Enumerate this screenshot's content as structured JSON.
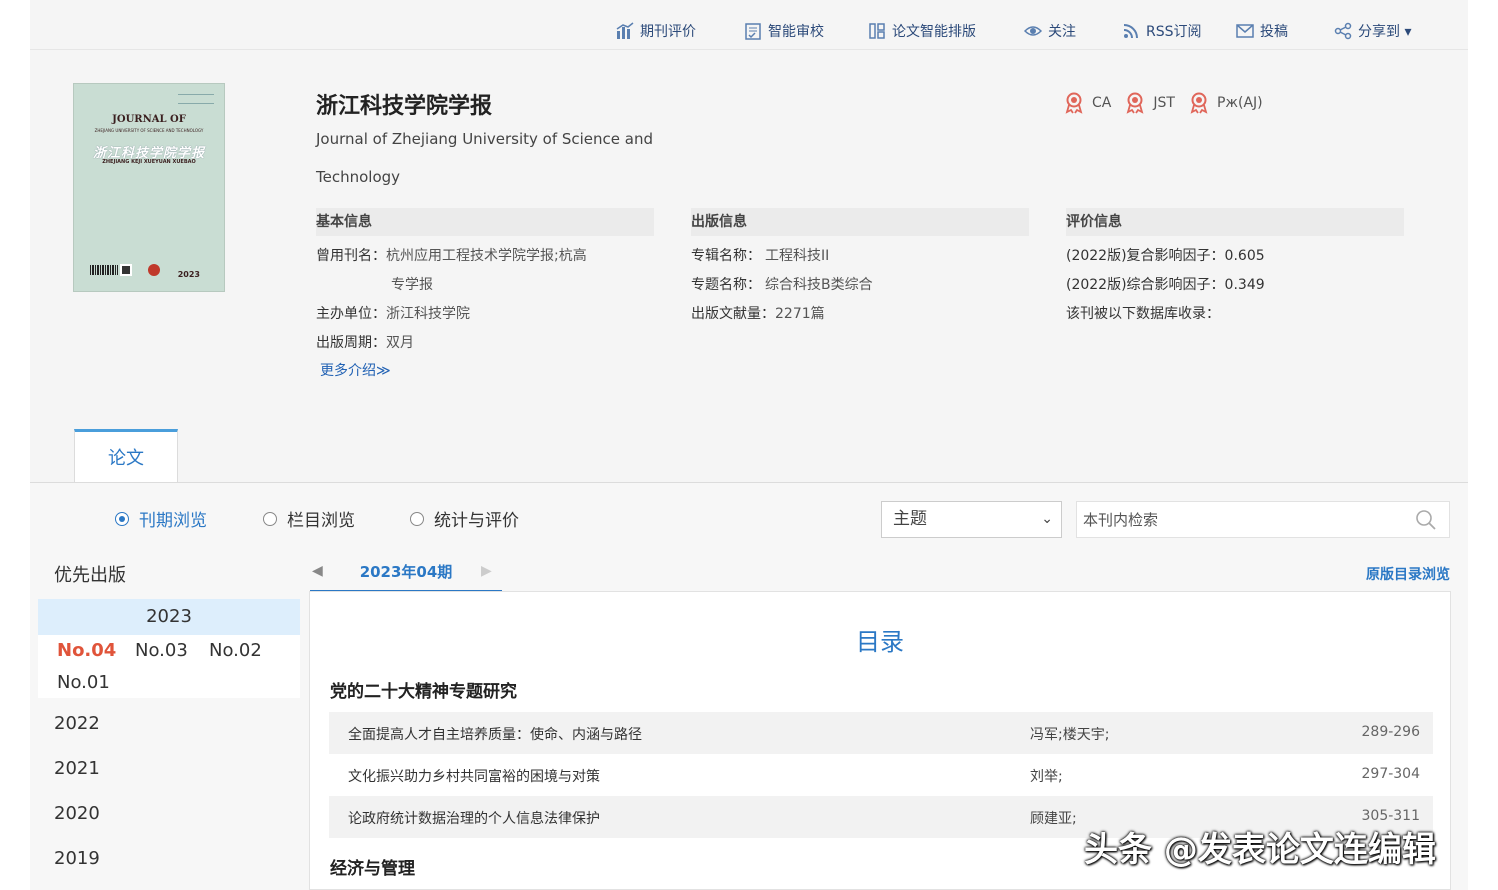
{
  "toolbar": {
    "items": [
      {
        "label": "期刊评价"
      },
      {
        "label": "智能审校"
      },
      {
        "label": "论文智能排版"
      },
      {
        "label": "关注"
      },
      {
        "label": "RSS订阅"
      },
      {
        "label": "投稿"
      },
      {
        "label": "分享到 ▾"
      }
    ]
  },
  "journal": {
    "title": "浙江科技学院学报",
    "title_en": "Journal of Zhejiang University of Science and Technology",
    "cover": {
      "line1": "JOURNAL OF",
      "line2": "ZHEJIANG UNIVERSITY OF SCIENCE AND TECHNOLOGY",
      "line3": "浙江科技学院学报",
      "line4": "ZHEJIANG KEJI XUEYUAN XUEBAO",
      "year": "2023"
    },
    "badges": [
      "CA",
      "JST",
      "Рж(AJ)"
    ]
  },
  "basic_info": {
    "heading": "基本信息",
    "former_name_label": "曾用刊名：",
    "former_name_value_1": "杭州应用工程技术学院学报;杭高",
    "former_name_value_2": "专学报",
    "sponsor_label": "主办单位：",
    "sponsor_value": "浙江科技学院",
    "cycle_label": "出版周期：",
    "cycle_value": "双月",
    "more": "更多介绍≫"
  },
  "publish_info": {
    "heading": "出版信息",
    "album_label": "专辑名称：",
    "album_value": "工程科技II",
    "topic_label": "专题名称：",
    "topic_value": "综合科技B类综合",
    "count_label": "出版文献量：",
    "count_value": "2271篇"
  },
  "eval_info": {
    "heading": "评价信息",
    "if_composite": "(2022版)复合影响因子：0.605",
    "if_comprehensive": "(2022版)综合影响因子：0.349",
    "indexed": "该刊被以下数据库收录："
  },
  "tabs": {
    "papers": "论文"
  },
  "browse": {
    "options": [
      "刊期浏览",
      "栏目浏览",
      "统计与评价"
    ],
    "select_value": "主题",
    "search_placeholder": "本刊内检索"
  },
  "sidebar": {
    "priority": "优先出版",
    "open_year": "2023",
    "issues": [
      "No.04",
      "No.03",
      "No.02",
      "No.01"
    ],
    "years": [
      "2022",
      "2021",
      "2020",
      "2019"
    ]
  },
  "issue_nav": {
    "current": "2023年04期",
    "original": "原版目录浏览"
  },
  "toc": {
    "title": "目录",
    "sections": [
      {
        "name": "党的二十大精神专题研究",
        "articles": [
          {
            "title": "全面提高人才自主培养质量：使命、内涵与路径",
            "authors": "冯军;楼天宇;",
            "pages": "289-296"
          },
          {
            "title": "文化振兴助力乡村共同富裕的困境与对策",
            "authors": "刘举;",
            "pages": "297-304"
          },
          {
            "title": "论政府统计数据治理的个人信息法律保护",
            "authors": "顾建亚;",
            "pages": "305-311"
          }
        ]
      },
      {
        "name": "经济与管理",
        "articles": []
      }
    ]
  },
  "watermark": "头条 @发表论文连编辑",
  "colors": {
    "accent": "#2b78c5",
    "active_issue": "#e0543a",
    "toolbar_text": "#2c4a7a",
    "badge": "#e0665a"
  }
}
